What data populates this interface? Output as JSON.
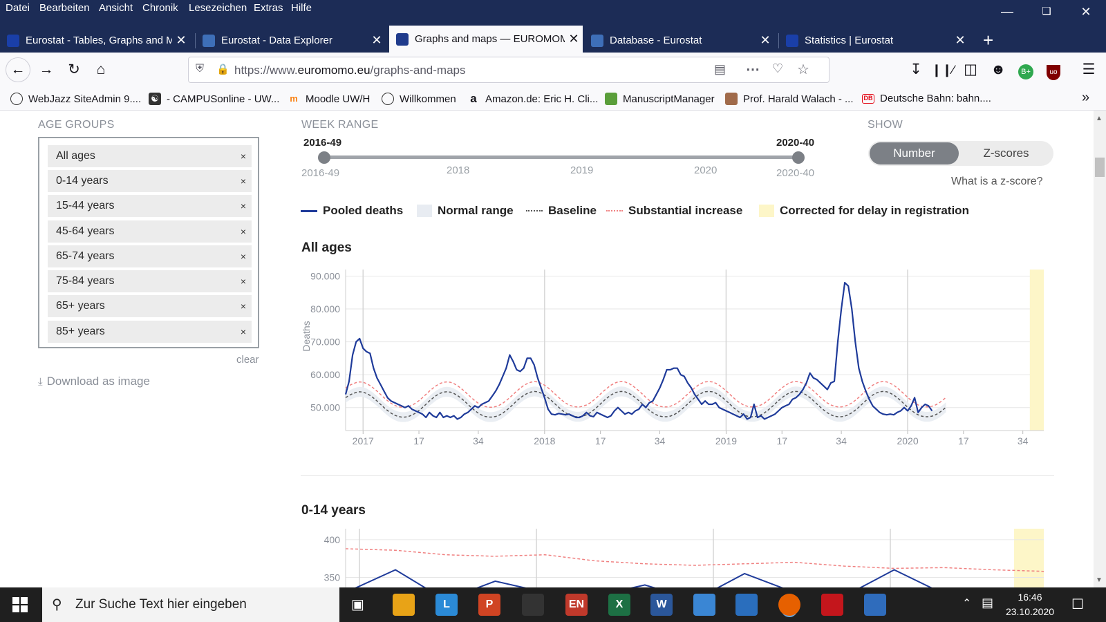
{
  "menu": [
    "Datei",
    "Bearbeiten",
    "Ansicht",
    "Chronik",
    "Lesezeichen",
    "Extras",
    "Hilfe"
  ],
  "tabs": [
    {
      "title": "Eurostat - Tables, Graphs and M",
      "color": "#1a3fa8"
    },
    {
      "title": "Eurostat - Data Explorer",
      "color": "#3e6fb8"
    },
    {
      "title": "Graphs and maps — EUROMOMO",
      "color": "#1f3b8c"
    },
    {
      "title": "Database - Eurostat",
      "color": "#3e6fb8"
    },
    {
      "title": "Statistics | Eurostat",
      "color": "#1a3fa8"
    }
  ],
  "url": {
    "prefix": "https://www.",
    "domain": "euromomo.eu",
    "path": "/graphs-and-maps"
  },
  "bookmarks": [
    {
      "label": "WebJazz SiteAdmin 9....",
      "icon": "globe-icon"
    },
    {
      "label": "- CAMPUSonline - UW...",
      "icon": "campus-icon"
    },
    {
      "label": "Moodle UW/H",
      "icon": "moodle-icon"
    },
    {
      "label": "Willkommen",
      "icon": "globe-icon"
    },
    {
      "label": "Amazon.de: Eric H. Cli...",
      "icon": "amazon-icon"
    },
    {
      "label": "ManuscriptManager",
      "icon": "people-icon"
    },
    {
      "label": "Prof. Harald Walach - ...",
      "icon": "portrait-icon"
    },
    {
      "label": "Deutsche Bahn: bahn....",
      "icon": "db-icon"
    }
  ],
  "sidebar": {
    "heading": "AGE GROUPS",
    "groups": [
      "All ages",
      "0-14 years",
      "15-44 years",
      "45-64 years",
      "65-74 years",
      "75-84 years",
      "65+ years",
      "85+ years"
    ],
    "remove_glyph": "×",
    "clear": "clear",
    "download": "Download as image"
  },
  "week_range": {
    "heading": "WEEK RANGE",
    "start": "2016-49",
    "end": "2020-40",
    "ticks": [
      "2016-49",
      "2018",
      "2019",
      "2020",
      "2020-40"
    ]
  },
  "show": {
    "heading": "SHOW",
    "options": [
      "Number",
      "Z-scores"
    ],
    "selected": "Number",
    "help": "What is a z-score?"
  },
  "legend": [
    "Pooled deaths",
    "Normal range",
    "Baseline",
    "Substantial increase",
    "Corrected for delay in registration"
  ],
  "chart_data": [
    {
      "type": "line",
      "title": "All ages",
      "ylabel": "Deaths",
      "ylim": [
        43000,
        92000
      ],
      "yticks": [
        "90.000",
        "80.000",
        "70.000",
        "60.000",
        "50.000"
      ],
      "ytick_values": [
        90000,
        80000,
        70000,
        60000,
        50000
      ],
      "xticks": [
        "2017",
        "17",
        "34",
        "2018",
        "17",
        "34",
        "2019",
        "17",
        "34",
        "2020",
        "17",
        "34"
      ],
      "xtick_weeks": [
        1,
        17,
        34,
        53,
        69,
        86,
        105,
        121,
        138,
        157,
        173,
        190
      ],
      "year_lines": [
        1,
        53,
        105,
        157
      ],
      "week_index_range": [
        -4,
        196
      ],
      "series": [
        {
          "name": "Pooled deaths",
          "color": "#1f3b9a",
          "values": [
            54000,
            58000,
            66000,
            70000,
            71000,
            68000,
            67000,
            66500,
            62000,
            59000,
            57000,
            55000,
            53000,
            52000,
            51500,
            51000,
            50500,
            50000,
            50500,
            49500,
            49000,
            48500,
            48000,
            47000,
            48500,
            47500,
            47000,
            48500,
            47000,
            47500,
            47000,
            47500,
            46500,
            47000,
            48000,
            48500,
            49500,
            50500,
            50000,
            51000,
            51500,
            52000,
            53500,
            55000,
            57000,
            59500,
            62000,
            66000,
            64000,
            61500,
            61000,
            62000,
            65000,
            65000,
            63000,
            59000,
            56000,
            53000,
            49500,
            48000,
            47800,
            48200,
            48000,
            47800,
            48000,
            47500,
            47000,
            47000,
            47500,
            48500,
            47500,
            47200,
            48500,
            48000,
            47500,
            47000,
            47500,
            49000,
            50000,
            49000,
            48000,
            48500,
            48000,
            49000,
            49500,
            51000,
            50000,
            51500,
            52000,
            54000,
            56000,
            58500,
            61500,
            61500,
            62000,
            62000,
            60000,
            59500,
            57500,
            56000,
            54000,
            52500,
            51000,
            52000,
            51000,
            51000,
            51500,
            50000,
            49500,
            49000,
            48500,
            48000,
            47500,
            47000,
            48000,
            46500,
            47000,
            51000,
            47000,
            47500,
            46500,
            47000,
            47500,
            48000,
            49000,
            50000,
            50500,
            51000,
            52500,
            53000,
            54000,
            55500,
            57500,
            60500,
            59000,
            58500,
            57500,
            56500,
            55500,
            57500,
            58000,
            70000,
            80000,
            88000,
            87000,
            80000,
            70000,
            62000,
            58000,
            55000,
            52500,
            50500,
            49500,
            48500,
            48000,
            47800,
            48000,
            47800,
            48500,
            49000,
            50000,
            49000,
            50500,
            53000,
            48500,
            50000,
            51000,
            50500,
            49000
          ]
        },
        {
          "name": "Baseline",
          "color": "#555",
          "values": [
            53000,
            53700,
            54200,
            54600,
            54800,
            54700,
            54300,
            53700,
            52900,
            52000,
            51000,
            50000,
            49100,
            48300,
            47700,
            47300,
            47100,
            47100,
            47300,
            47700,
            48300,
            49100,
            50000,
            51000,
            52000,
            52900,
            53700,
            54300,
            54700,
            54800,
            54700,
            54300,
            53700,
            52900,
            52000,
            51000,
            50000,
            49100,
            48300,
            47700,
            47300,
            47100,
            47100,
            47300,
            47700,
            48300,
            49100,
            50000,
            51000,
            52000,
            52900,
            53700,
            54300,
            54700,
            54900,
            54800,
            54400,
            53800,
            53000,
            52100,
            51100,
            50100,
            49200,
            48400,
            47800,
            47400,
            47200,
            47200,
            47400,
            47800,
            48400,
            49200,
            50100,
            51100,
            52100,
            53000,
            53800,
            54400,
            54800,
            54900,
            54800,
            54400,
            53800,
            53000,
            52100,
            51100,
            50100,
            49200,
            48400,
            47800,
            47400,
            47200,
            47200,
            47400,
            47800,
            48400,
            49200,
            50100,
            51100,
            52100,
            53000,
            53800,
            54400,
            54800,
            54900,
            54800,
            54400,
            53800,
            53000,
            52100,
            51100,
            50100,
            49200,
            48400,
            47800,
            47400,
            47200,
            47200,
            47400,
            47800,
            48400,
            49200,
            50100,
            51100,
            52100,
            53000,
            53800,
            54400,
            54800,
            54900,
            54800,
            54400,
            53800,
            53000,
            52100,
            51100,
            50100,
            49200,
            48400,
            47800,
            47400,
            47200,
            47200,
            47400,
            47800,
            48400,
            49200,
            50100,
            51100,
            52100,
            53000,
            53800,
            54400,
            54800,
            54900,
            54800,
            54400,
            53800,
            53000,
            52100,
            51100,
            50100,
            49200,
            48400,
            47800,
            47400,
            47200,
            47200,
            47400,
            47800,
            48400,
            49200,
            50100
          ]
        },
        {
          "name": "Substantial increase",
          "color": "#f08080",
          "values": [
            56000,
            56700,
            57200,
            57600,
            57800,
            57700,
            57300,
            56700,
            55900,
            55000,
            54000,
            53000,
            52100,
            51300,
            50700,
            50300,
            50100,
            50100,
            50300,
            50700,
            51300,
            52100,
            53000,
            54000,
            55000,
            55900,
            56700,
            57300,
            57700,
            57800,
            57700,
            57300,
            56700,
            55900,
            55000,
            54000,
            53000,
            52100,
            51300,
            50700,
            50300,
            50100,
            50100,
            50300,
            50700,
            51300,
            52100,
            53000,
            54000,
            55000,
            55900,
            56700,
            57300,
            57700,
            57900,
            57800,
            57400,
            56800,
            56000,
            55100,
            54100,
            53100,
            52200,
            51400,
            50800,
            50400,
            50200,
            50200,
            50400,
            50800,
            51400,
            52200,
            53100,
            54100,
            55100,
            56000,
            56800,
            57400,
            57800,
            57900,
            57800,
            57400,
            56800,
            56000,
            55100,
            54100,
            53100,
            52200,
            51400,
            50800,
            50400,
            50200,
            50200,
            50400,
            50800,
            51400,
            52200,
            53100,
            54100,
            55100,
            56000,
            56800,
            57400,
            57800,
            57900,
            57800,
            57400,
            56800,
            56000,
            55100,
            54100,
            53100,
            52200,
            51400,
            50800,
            50400,
            50200,
            50200,
            50400,
            50800,
            51400,
            52200,
            53100,
            54100,
            55100,
            56000,
            56800,
            57400,
            57800,
            57900,
            57800,
            57400,
            56800,
            56000,
            55100,
            54100,
            53100,
            52200,
            51400,
            50800,
            50400,
            50200,
            50200,
            50400,
            50800,
            51400,
            52200,
            53100,
            54100,
            55100,
            56000,
            56800,
            57400,
            57800,
            57900,
            57800,
            57400,
            56800,
            56000,
            55100,
            54100,
            53100,
            52200,
            51400,
            50800,
            50400,
            50200,
            50200,
            50400,
            50800,
            51400,
            52200,
            53100
          ]
        }
      ],
      "week_start": -4
    },
    {
      "type": "line",
      "title": "0-14 years",
      "ylim": [
        300,
        410
      ],
      "yticks": [
        "400",
        "350"
      ],
      "ytick_values": [
        400,
        350
      ],
      "series": [
        {
          "name": "Substantial increase",
          "color": "#f08080",
          "values": [
            388,
            386,
            380,
            378,
            380,
            372,
            368,
            366,
            368,
            370,
            365,
            362,
            363,
            360,
            358
          ]
        },
        {
          "name": "Pooled deaths",
          "color": "#1f3b9a",
          "values": [
            330,
            360,
            320,
            345,
            330,
            325,
            340,
            320,
            355,
            330,
            325,
            360,
            328,
            335,
            330
          ]
        }
      ]
    }
  ],
  "taskbar": {
    "search": "Zur Suche Text hier eingeben",
    "time": "16:46",
    "date": "23.10.2020",
    "apps": [
      {
        "label": "",
        "color": "#e8a317"
      },
      {
        "label": "L",
        "color": "#2b8ad6"
      },
      {
        "label": "P",
        "color": "#d04423"
      },
      {
        "label": "",
        "color": "#333"
      },
      {
        "label": "EN",
        "color": "#c0392b"
      },
      {
        "label": "X",
        "color": "#1d7044"
      },
      {
        "label": "W",
        "color": "#2b579a"
      },
      {
        "label": "",
        "color": "#3a86d4"
      },
      {
        "label": "",
        "color": "#2a6ebd"
      },
      {
        "label": "",
        "color": "#e66000"
      },
      {
        "label": "",
        "color": "#c4161c"
      },
      {
        "label": "",
        "color": "#2f6cbc"
      }
    ]
  }
}
